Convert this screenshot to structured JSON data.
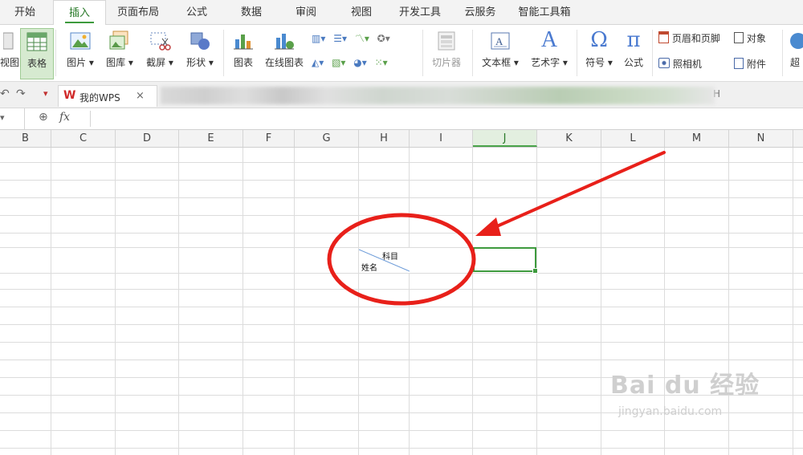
{
  "menu": {
    "tabs": [
      {
        "label": "开始"
      },
      {
        "label": "插入",
        "active": true
      },
      {
        "label": "页面布局"
      },
      {
        "label": "公式"
      },
      {
        "label": "数据"
      },
      {
        "label": "审阅"
      },
      {
        "label": "视图"
      },
      {
        "label": "开发工具"
      },
      {
        "label": "云服务"
      },
      {
        "label": "智能工具箱"
      }
    ]
  },
  "ribbon": {
    "view_partial": "视图",
    "table": "表格",
    "picture": "图片",
    "gallery": "图库",
    "screenshot": "截屏",
    "shapes": "形状",
    "chart": "图表",
    "online_chart": "在线图表",
    "slicer": "切片器",
    "textbox": "文本框",
    "wordart": "艺术字",
    "symbol": "符号",
    "formula": "公式",
    "header_footer": "页眉和页脚",
    "object": "对象",
    "camera": "照相机",
    "attachment": "附件",
    "hyperlink_partial": "超",
    "omega_glyph": "Ω",
    "pi_glyph": "π",
    "wordart_glyph": "A"
  },
  "tabbar": {
    "wps_tab": "我的WPS",
    "close_glyph": "×",
    "overflow_glyph": "H"
  },
  "formula_bar": {
    "fx": "fx"
  },
  "columns": [
    "B",
    "C",
    "D",
    "E",
    "F",
    "G",
    "H",
    "I",
    "J",
    "K",
    "L",
    "M",
    "N"
  ],
  "selected_column": "J",
  "cells": {
    "header_top": "科目",
    "header_bottom": "姓名"
  },
  "watermark": {
    "brand": "Bai  du 经验",
    "url": "jingyan.baidu.com"
  },
  "colors": {
    "accent_green": "#3e9a3e",
    "annotation_red": "#e8201a"
  }
}
